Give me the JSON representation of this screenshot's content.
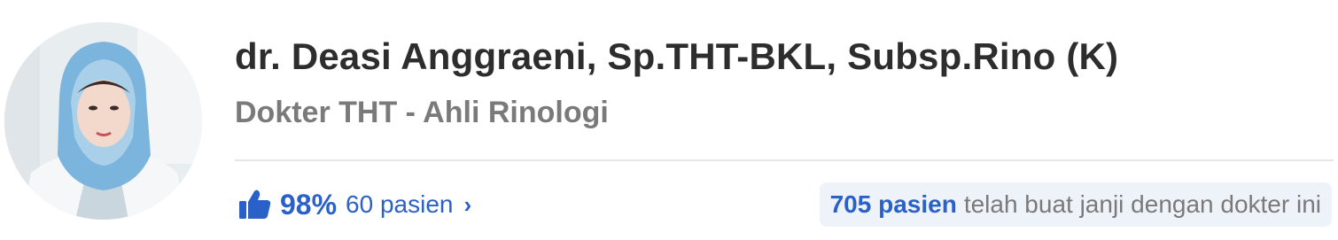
{
  "doctor": {
    "name": "dr. Deasi Anggraeni, Sp.THT-BKL, Subsp.Rino (K)",
    "specialty": "Dokter THT - Ahli Rinologi",
    "avatar_icon": "doctor-photo"
  },
  "rating": {
    "icon": "thumbs-up-icon",
    "percent": "98%",
    "reviews": "60 pasien",
    "chevron": "›"
  },
  "appointments": {
    "count": "705 pasien",
    "text": "telah buat janji dengan dokter ini"
  },
  "colors": {
    "accent": "#2a61c9",
    "name": "#2d2d2d",
    "muted": "#7a7a7a",
    "badge_bg": "#eef3fa",
    "divider": "#e6e6e6"
  }
}
